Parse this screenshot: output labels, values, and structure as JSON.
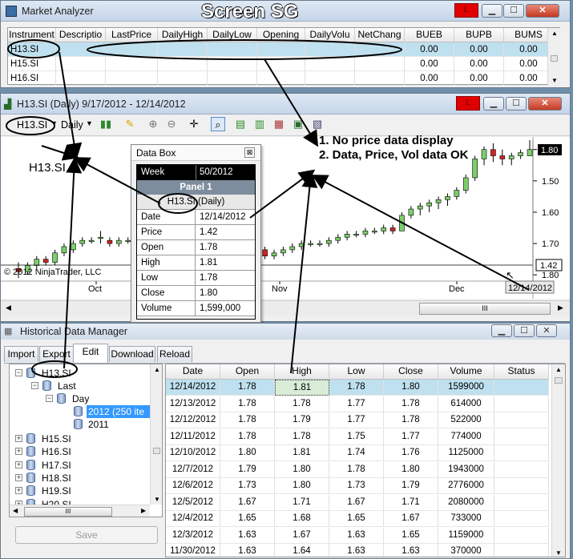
{
  "annotation": {
    "screen_label": "Screen SG",
    "note1": "1. No price data display",
    "note2": "2. Data, Price, Vol data OK",
    "instrument_callout": "H13.SI"
  },
  "market_analyzer": {
    "title": "Market Analyzer",
    "red_indicator": "L",
    "columns": [
      "Instrument",
      "Descriptio",
      "LastPrice",
      "DailyHigh",
      "DailyLow",
      "Opening",
      "DailyVolu",
      "NetChang",
      "BUEB",
      "BUPB",
      "BUMS"
    ],
    "rows": [
      {
        "instrument": "H13.SI",
        "bueb": "0.00",
        "bupb": "0.00",
        "bums": "0.00"
      },
      {
        "instrument": "H15.SI",
        "bueb": "0.00",
        "bupb": "0.00",
        "bums": "0.00"
      },
      {
        "instrument": "H16.SI",
        "bueb": "0.00",
        "bupb": "0.00",
        "bums": "0.00"
      }
    ]
  },
  "chart_window": {
    "title": "H13.SI (Daily)  9/17/2012 - 12/14/2012",
    "red_indicator": "L",
    "instrument": "H13.SI",
    "period": "Daily",
    "copyright": "© 2012 NinjaTrader, LLC",
    "crosshair_price": "1.42",
    "crosshair_date": "12/14/2012",
    "last_price": "1.80",
    "x_ticks": [
      "Oct",
      "Nov",
      "Dec"
    ],
    "y_ticks": [
      "1.80",
      "1.70",
      "1.60",
      "1.50",
      "1.40"
    ]
  },
  "chart_data": {
    "type": "candlestick",
    "title": "",
    "xlabel": "",
    "ylabel": "",
    "ylim": [
      1.38,
      1.83
    ],
    "y_ticks": [
      1.4,
      1.5,
      1.6,
      1.7,
      1.8
    ],
    "x_ticks": [
      "Oct",
      "Nov",
      "Dec"
    ],
    "series": [
      {
        "name": "H13.SI",
        "ohlc": [
          [
            1.42,
            1.44,
            1.39,
            1.41
          ],
          [
            1.41,
            1.44,
            1.4,
            1.43
          ],
          [
            1.43,
            1.46,
            1.42,
            1.45
          ],
          [
            1.45,
            1.46,
            1.43,
            1.44
          ],
          [
            1.44,
            1.48,
            1.43,
            1.47
          ],
          [
            1.47,
            1.5,
            1.46,
            1.49
          ],
          [
            1.48,
            1.51,
            1.47,
            1.5
          ],
          [
            1.5,
            1.52,
            1.49,
            1.51
          ],
          [
            1.51,
            1.52,
            1.5,
            1.51
          ],
          [
            1.52,
            1.54,
            1.5,
            1.52
          ],
          [
            1.51,
            1.52,
            1.49,
            1.5
          ],
          [
            1.5,
            1.52,
            1.49,
            1.51
          ],
          [
            1.51,
            1.52,
            1.5,
            1.51
          ],
          [
            1.51,
            1.52,
            1.5,
            1.51
          ],
          [
            1.5,
            1.51,
            1.49,
            1.5
          ],
          [
            1.5,
            1.51,
            1.49,
            1.5
          ],
          [
            1.5,
            1.51,
            1.48,
            1.49
          ],
          [
            1.49,
            1.5,
            1.47,
            1.48
          ],
          [
            1.48,
            1.49,
            1.46,
            1.47
          ],
          [
            1.47,
            1.48,
            1.45,
            1.47
          ],
          [
            1.48,
            1.49,
            1.47,
            1.48
          ],
          [
            1.48,
            1.49,
            1.46,
            1.47
          ],
          [
            1.47,
            1.48,
            1.45,
            1.47
          ],
          [
            1.48,
            1.49,
            1.47,
            1.48
          ],
          [
            1.48,
            1.49,
            1.46,
            1.47
          ],
          [
            1.47,
            1.48,
            1.45,
            1.48
          ],
          [
            1.48,
            1.49,
            1.47,
            1.48
          ],
          [
            1.48,
            1.49,
            1.45,
            1.46
          ],
          [
            1.46,
            1.48,
            1.45,
            1.47
          ],
          [
            1.47,
            1.49,
            1.46,
            1.48
          ],
          [
            1.48,
            1.5,
            1.47,
            1.49
          ],
          [
            1.49,
            1.51,
            1.48,
            1.5
          ],
          [
            1.5,
            1.51,
            1.49,
            1.5
          ],
          [
            1.5,
            1.51,
            1.49,
            1.5
          ],
          [
            1.5,
            1.52,
            1.49,
            1.51
          ],
          [
            1.51,
            1.53,
            1.5,
            1.52
          ],
          [
            1.52,
            1.54,
            1.51,
            1.53
          ],
          [
            1.53,
            1.54,
            1.52,
            1.53
          ],
          [
            1.53,
            1.55,
            1.52,
            1.54
          ],
          [
            1.54,
            1.55,
            1.53,
            1.54
          ],
          [
            1.54,
            1.56,
            1.53,
            1.55
          ],
          [
            1.55,
            1.56,
            1.53,
            1.54
          ],
          [
            1.54,
            1.6,
            1.54,
            1.59
          ],
          [
            1.59,
            1.62,
            1.58,
            1.61
          ],
          [
            1.61,
            1.63,
            1.59,
            1.62
          ],
          [
            1.62,
            1.64,
            1.6,
            1.63
          ],
          [
            1.63,
            1.65,
            1.61,
            1.64
          ],
          [
            1.64,
            1.66,
            1.62,
            1.65
          ],
          [
            1.65,
            1.68,
            1.64,
            1.67
          ],
          [
            1.67,
            1.72,
            1.66,
            1.71
          ],
          [
            1.71,
            1.78,
            1.7,
            1.77
          ],
          [
            1.77,
            1.81,
            1.75,
            1.8
          ],
          [
            1.8,
            1.82,
            1.76,
            1.78
          ],
          [
            1.78,
            1.8,
            1.75,
            1.77
          ],
          [
            1.77,
            1.79,
            1.75,
            1.78
          ],
          [
            1.78,
            1.8,
            1.77,
            1.79
          ],
          [
            1.78,
            1.83,
            1.78,
            1.8
          ]
        ]
      }
    ]
  },
  "data_box": {
    "title": "Data Box",
    "week_label": "Week",
    "week_value": "50/2012",
    "panel": "Panel 1",
    "series": "H13.SI (Daily)",
    "rows": [
      {
        "label": "Date",
        "value": "12/14/2012"
      },
      {
        "label": "Price",
        "value": "1.42"
      },
      {
        "label": "Open",
        "value": "1.78"
      },
      {
        "label": "High",
        "value": "1.81"
      },
      {
        "label": "Low",
        "value": "1.78"
      },
      {
        "label": "Close",
        "value": "1.80"
      },
      {
        "label": "Volume",
        "value": "1,599,000"
      }
    ]
  },
  "historical_data_manager": {
    "title": "Historical Data Manager",
    "tabs": [
      "Import",
      "Export",
      "Edit",
      "Download",
      "Reload"
    ],
    "active_tab": "Edit",
    "tree": {
      "root": "H13.SI",
      "last": "Last",
      "day": "Day",
      "year_selected": "2012 (250 ite",
      "year_other": "2011",
      "others": [
        "H15.SI",
        "H16.SI",
        "H17.SI",
        "H18.SI",
        "H19.SI",
        "H20.SI"
      ]
    },
    "save_label": "Save",
    "columns": [
      "Date",
      "Open",
      "High",
      "Low",
      "Close",
      "Volume",
      "Status"
    ],
    "rows": [
      [
        "12/14/2012",
        "1.78",
        "1.81",
        "1.78",
        "1.80",
        "1599000",
        ""
      ],
      [
        "12/13/2012",
        "1.78",
        "1.78",
        "1.77",
        "1.78",
        "614000",
        ""
      ],
      [
        "12/12/2012",
        "1.78",
        "1.79",
        "1.77",
        "1.78",
        "522000",
        ""
      ],
      [
        "12/11/2012",
        "1.78",
        "1.78",
        "1.75",
        "1.77",
        "774000",
        ""
      ],
      [
        "12/10/2012",
        "1.80",
        "1.81",
        "1.74",
        "1.76",
        "1125000",
        ""
      ],
      [
        "12/7/2012",
        "1.79",
        "1.80",
        "1.78",
        "1.80",
        "1943000",
        ""
      ],
      [
        "12/6/2012",
        "1.73",
        "1.80",
        "1.73",
        "1.79",
        "2776000",
        ""
      ],
      [
        "12/5/2012",
        "1.67",
        "1.71",
        "1.67",
        "1.71",
        "2080000",
        ""
      ],
      [
        "12/4/2012",
        "1.65",
        "1.68",
        "1.65",
        "1.67",
        "733000",
        ""
      ],
      [
        "12/3/2012",
        "1.63",
        "1.67",
        "1.63",
        "1.65",
        "1159000",
        ""
      ],
      [
        "11/30/2012",
        "1.63",
        "1.64",
        "1.63",
        "1.63",
        "370000",
        ""
      ]
    ]
  }
}
